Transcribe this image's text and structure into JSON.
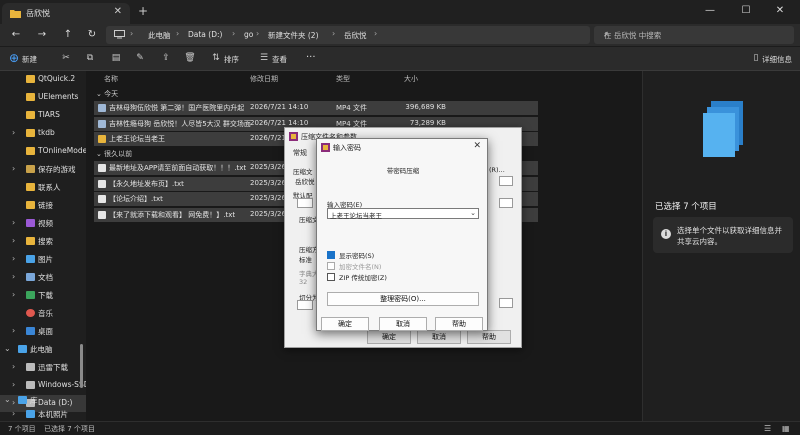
{
  "window": {
    "tab_title": "岳欣悦",
    "new_tab": "+",
    "minimize": "—",
    "maximize": "☐",
    "close": "✕"
  },
  "nav": {
    "breadcrumb": [
      "此电脑",
      "Data (D:)",
      "go",
      "新建文件夹 (2)",
      "岳欣悦"
    ],
    "search_placeholder": "在 岳欣悦 中搜索"
  },
  "toolbar": {
    "new_label": "新建",
    "sort_label": "排序",
    "view_label": "查看",
    "more_label": "···",
    "details_label": "详细信息"
  },
  "sidebar": {
    "items": [
      {
        "label": "QtQuick.2",
        "icon": "folder-icon"
      },
      {
        "label": "UElements",
        "icon": "folder-icon"
      },
      {
        "label": "TIARS",
        "icon": "folder-icon"
      },
      {
        "label": "tkdb",
        "icon": "folder-icon"
      },
      {
        "label": "TOnlineMode",
        "icon": "folder-icon"
      },
      {
        "label": "保存的游戏",
        "icon": "folder-icon"
      },
      {
        "label": "联系人",
        "icon": "contacts-icon"
      },
      {
        "label": "链接",
        "icon": "links-icon"
      },
      {
        "label": "视频",
        "icon": "video-icon"
      },
      {
        "label": "搜索",
        "icon": "search-folder-icon"
      },
      {
        "label": "图片",
        "icon": "pictures-icon"
      },
      {
        "label": "文档",
        "icon": "documents-icon"
      },
      {
        "label": "下载",
        "icon": "downloads-icon"
      },
      {
        "label": "音乐",
        "icon": "music-icon"
      },
      {
        "label": "桌面",
        "icon": "desktop-icon"
      },
      {
        "label": "此电脑",
        "icon": "pc-icon"
      },
      {
        "label": "迅雷下载",
        "icon": "drive-icon"
      },
      {
        "label": "Windows-SSD",
        "icon": "drive-icon"
      },
      {
        "label": "Data (D:)",
        "icon": "drive-icon"
      },
      {
        "label": "库",
        "icon": "library-icon"
      },
      {
        "label": "本机照片",
        "icon": "photos-icon"
      }
    ]
  },
  "filelist": {
    "columns": {
      "name": "名称",
      "date": "修改日期",
      "type": "类型",
      "size": "大小"
    },
    "groups": [
      {
        "label": "今天",
        "rows": [
          {
            "name": "吉林母狗伍欣悦 第二弹！国产医院里内升起",
            "date": "2026/7/21 14:10",
            "type": "MP4 文件",
            "size": "396,689 KB",
            "icon": "video-file-icon"
          },
          {
            "name": "吉林性瘾母狗 岳欣悦！人尽皆5大汉 群交场面",
            "date": "2026/7/21 14:10",
            "type": "MP4 文件",
            "size": "73,289 KB",
            "icon": "video-file-icon"
          },
          {
            "name": "上老王论坛当老王",
            "date": "2026/7/21 14:10",
            "type": "",
            "size": "",
            "icon": "folder-icon"
          }
        ]
      },
      {
        "label": "很久以前",
        "rows": [
          {
            "name": "最新地址及APP请至前面自动获取！！！.txt",
            "date": "2025/3/26",
            "type": "",
            "size": "",
            "icon": "txt-file-icon"
          },
          {
            "name": "【永久地址发布页】.txt",
            "date": "2025/3/26",
            "type": "",
            "size": "",
            "icon": "txt-file-icon"
          },
          {
            "name": "【论坛介绍】.txt",
            "date": "2025/3/26",
            "type": "",
            "size": "",
            "icon": "txt-file-icon"
          },
          {
            "name": "【来了就添下载和观看】 网免费！】.txt",
            "date": "2025/3/26",
            "type": "",
            "size": "",
            "icon": "txt-file-icon"
          }
        ]
      }
    ]
  },
  "details": {
    "selected_text": "已选择 7 个项目",
    "info_text": "选择单个文件以获取详细信息并共享云内容。"
  },
  "statusbar": {
    "count": "7 个项目",
    "selected": "已选择 7 个项目"
  },
  "dialog_back": {
    "title": "压缩文件名和参数",
    "tab_general": "常规",
    "labels": [
      "压缩文",
      "岳欣悦",
      "默认配",
      "压缩文",
      "压缩方",
      "标准",
      "字典大",
      "32",
      "切分为"
    ],
    "ok": "确定",
    "cancel": "取消",
    "help": "帮助",
    "side_text": "(R)..."
  },
  "dialog_front": {
    "title": "输入密码",
    "subtitle": "带密码压缩",
    "password_label": "输入密码(E)",
    "password_value": "上老王论坛当老王",
    "show_password": "显示密码(S)",
    "encrypt_names": "加密文件名(N)",
    "zip_legacy": "ZIP 传统加密(Z)",
    "organize_button": "整理密码(O)...",
    "ok": "确定",
    "cancel": "取消",
    "help": "帮助"
  },
  "colors": {
    "folder": "#e8b43c",
    "accent": "#1a73c9"
  }
}
